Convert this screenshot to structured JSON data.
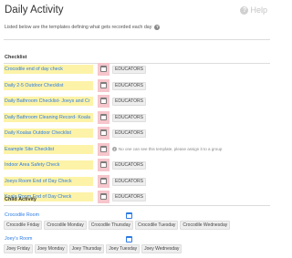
{
  "header": {
    "title": "Daily Activity",
    "help_label": "Help",
    "help_icon": "help-circle-icon"
  },
  "subtitle": "Listed below are the templates defining what gets recorded each day",
  "subtitle_icon": "question-circle-icon",
  "checklist": {
    "title": "Checklist",
    "items": [
      {
        "name": "Crocodile end of day check",
        "tag": "EDUCATORS"
      },
      {
        "name": "Daily 2-5 Outdoor Checklist",
        "tag": "EDUCATORS"
      },
      {
        "name": "Daily Bathroom Checklist- Joeys and Cr",
        "tag": "EDUCATORS"
      },
      {
        "name": "Daily Bathroom Cleaning Record- Koala",
        "tag": "EDUCATORS"
      },
      {
        "name": "Daily Koalas Outdoor Checklist",
        "tag": "EDUCATORS"
      },
      {
        "name": "Example Site Checklist",
        "warning": "No one can see this template, please assign it to a group"
      },
      {
        "name": "Indoor Area Safety Check",
        "tag": "EDUCATORS"
      },
      {
        "name": "Joeys Room End of Day Check",
        "tag": "EDUCATORS"
      },
      {
        "name": "Koala Room End of Day Check",
        "tag": "EDUCATORS"
      }
    ]
  },
  "child_activity": {
    "title": "Child Activity",
    "rooms": [
      {
        "name": "Crocodile Room",
        "chips": [
          "Crocodile Friday",
          "Crocodile Monday",
          "Crocodile Thursday",
          "Crocodile Tuesday",
          "Crocodile Wednesday"
        ]
      },
      {
        "name": "Joey's Room",
        "chips": [
          "Joey Friday",
          "Joey Monday",
          "Joey Thursday",
          "Joey Tuesday",
          "Joey Wednesday"
        ]
      }
    ]
  },
  "colors": {
    "link": "#2c7be5",
    "highlight": "#fdf3a8",
    "calendar_cell": "#f6c6cc"
  }
}
